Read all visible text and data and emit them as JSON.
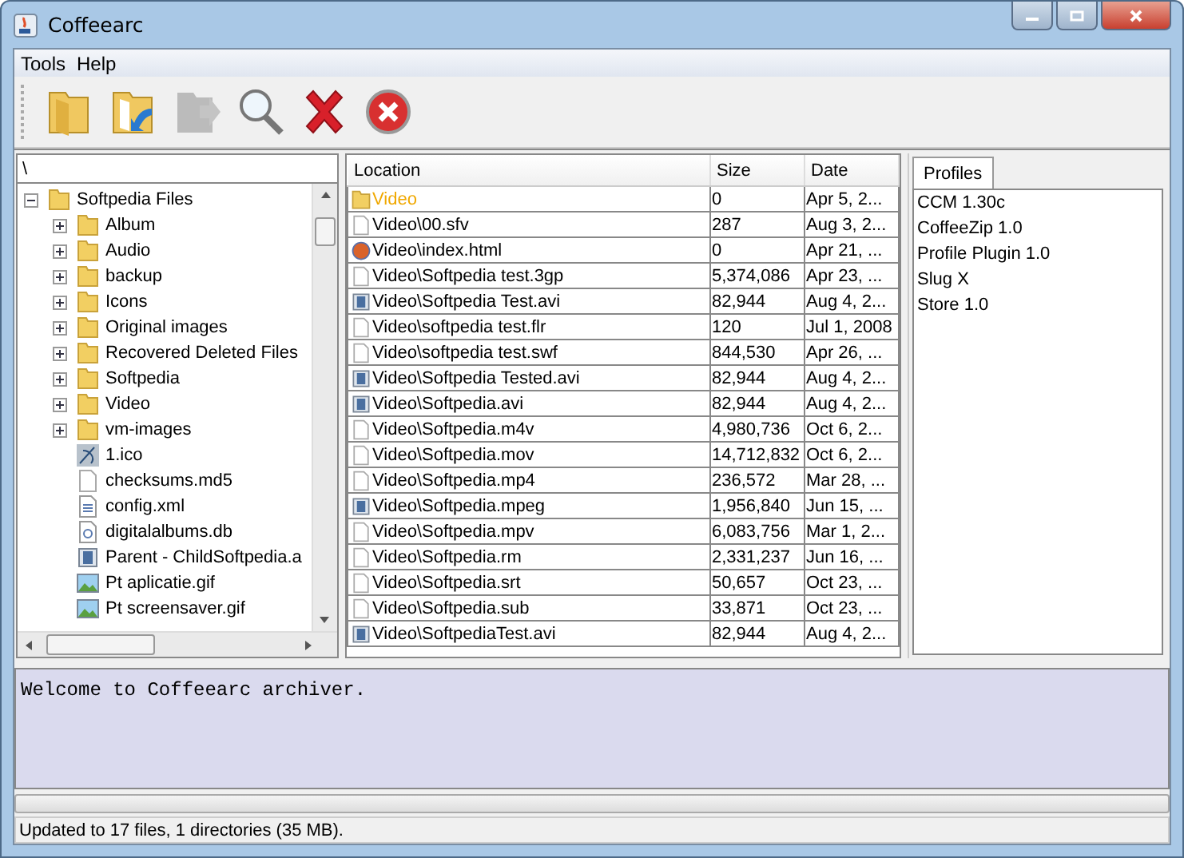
{
  "window": {
    "title": "Coffeearc"
  },
  "menu": [
    "Tools",
    "Help"
  ],
  "toolbar": [
    {
      "kind": "open",
      "disabled": false
    },
    {
      "kind": "extract",
      "disabled": false
    },
    {
      "kind": "export",
      "disabled": true
    },
    {
      "kind": "search",
      "disabled": false
    },
    {
      "kind": "delete",
      "disabled": false
    },
    {
      "kind": "stop",
      "disabled": false
    }
  ],
  "tree": {
    "path": "\\",
    "root": {
      "label": "Softpedia Files",
      "kind": "folder",
      "expanded": true,
      "children": [
        {
          "label": "Album",
          "kind": "folder",
          "expanded": false
        },
        {
          "label": "Audio",
          "kind": "folder",
          "expanded": false
        },
        {
          "label": "backup",
          "kind": "folder",
          "expanded": false
        },
        {
          "label": "Icons",
          "kind": "folder",
          "expanded": false
        },
        {
          "label": "Original images",
          "kind": "folder",
          "expanded": false
        },
        {
          "label": "Recovered Deleted Files",
          "kind": "folder",
          "expanded": false
        },
        {
          "label": "Softpedia",
          "kind": "folder",
          "expanded": false
        },
        {
          "label": "Video",
          "kind": "folder",
          "expanded": false
        },
        {
          "label": "vm-images",
          "kind": "folder",
          "expanded": false
        },
        {
          "label": "1.ico",
          "kind": "ico"
        },
        {
          "label": "checksums.md5",
          "kind": "file"
        },
        {
          "label": "config.xml",
          "kind": "xml"
        },
        {
          "label": "digitalalbums.db",
          "kind": "db"
        },
        {
          "label": "Parent - ChildSoftpedia.a",
          "kind": "video"
        },
        {
          "label": "Pt aplicatie.gif",
          "kind": "image"
        },
        {
          "label": "Pt screensaver.gif",
          "kind": "image"
        }
      ]
    }
  },
  "table": {
    "columns": [
      "Location",
      "Size",
      "Date"
    ],
    "rows": [
      {
        "kind": "folder",
        "location": "Video",
        "size": "0",
        "date": "Apr 5, 2..."
      },
      {
        "kind": "file",
        "location": "Video\\00.sfv",
        "size": "287",
        "date": "Aug 3, 2..."
      },
      {
        "kind": "web",
        "location": "Video\\index.html",
        "size": "0",
        "date": "Apr 21, ..."
      },
      {
        "kind": "file",
        "location": "Video\\Softpedia test.3gp",
        "size": "5,374,086",
        "date": "Apr 23, ..."
      },
      {
        "kind": "video",
        "location": "Video\\Softpedia Test.avi",
        "size": "82,944",
        "date": "Aug 4, 2..."
      },
      {
        "kind": "file",
        "location": "Video\\softpedia test.flr",
        "size": "120",
        "date": "Jul 1, 2008"
      },
      {
        "kind": "file",
        "location": "Video\\softpedia test.swf",
        "size": "844,530",
        "date": "Apr 26, ..."
      },
      {
        "kind": "video",
        "location": "Video\\Softpedia Tested.avi",
        "size": "82,944",
        "date": "Aug 4, 2..."
      },
      {
        "kind": "video",
        "location": "Video\\Softpedia.avi",
        "size": "82,944",
        "date": "Aug 4, 2..."
      },
      {
        "kind": "file",
        "location": "Video\\Softpedia.m4v",
        "size": "4,980,736",
        "date": "Oct 6, 2..."
      },
      {
        "kind": "file",
        "location": "Video\\Softpedia.mov",
        "size": "14,712,832",
        "date": "Oct 6, 2..."
      },
      {
        "kind": "file",
        "location": "Video\\Softpedia.mp4",
        "size": "236,572",
        "date": "Mar 28, ..."
      },
      {
        "kind": "video",
        "location": "Video\\Softpedia.mpeg",
        "size": "1,956,840",
        "date": "Jun 15, ..."
      },
      {
        "kind": "file",
        "location": "Video\\Softpedia.mpv",
        "size": "6,083,756",
        "date": "Mar 1, 2..."
      },
      {
        "kind": "file",
        "location": "Video\\Softpedia.rm",
        "size": "2,331,237",
        "date": "Jun 16, ..."
      },
      {
        "kind": "file",
        "location": "Video\\Softpedia.srt",
        "size": "50,657",
        "date": "Oct 23, ..."
      },
      {
        "kind": "file",
        "location": "Video\\Softpedia.sub",
        "size": "33,871",
        "date": "Oct 23, ..."
      },
      {
        "kind": "video",
        "location": "Video\\SoftpediaTest.avi",
        "size": "82,944",
        "date": "Aug 4, 2..."
      }
    ]
  },
  "profiles": {
    "tabs": [
      {
        "label": "Profiles",
        "selected": true
      }
    ],
    "items": [
      "CCM 1.30c",
      "CoffeeZip 1.0",
      "Profile Plugin 1.0",
      "Slug X",
      "Store 1.0"
    ]
  },
  "console": {
    "text": "Welcome to Coffeearc archiver."
  },
  "progress": {
    "level": 0
  },
  "status_bar": "Updated to 17 files, 1 directories (35 MB)."
}
